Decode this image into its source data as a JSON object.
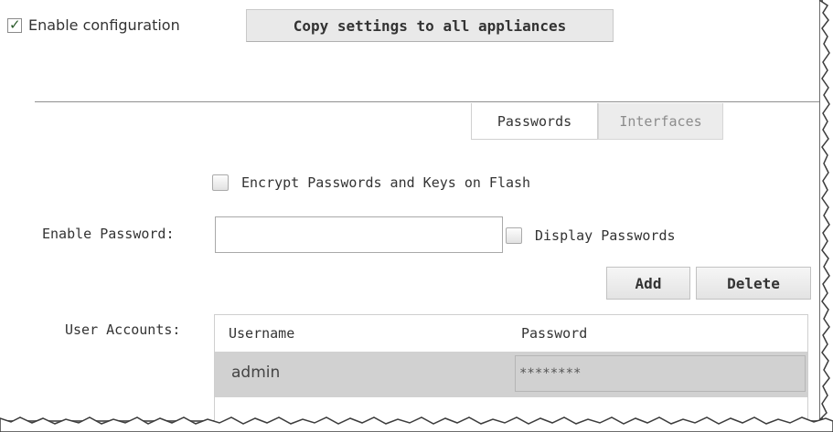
{
  "header": {
    "enable_label": "Enable configuration",
    "enable_checked": true,
    "copy_button": "Copy settings to all appliances"
  },
  "tabs": [
    {
      "label": "Passwords",
      "active": true
    },
    {
      "label": "Interfaces",
      "active": false
    }
  ],
  "form": {
    "encrypt_label": "Encrypt Passwords and Keys on Flash",
    "encrypt_checked": false,
    "enable_password_label": "Enable Password:",
    "enable_password_value": "",
    "display_passwords_label": "Display Passwords",
    "display_passwords_checked": false,
    "add_button": "Add",
    "delete_button": "Delete",
    "user_accounts_label": "User Accounts:"
  },
  "table": {
    "columns": [
      "Username",
      "Password"
    ],
    "rows": [
      {
        "username": "admin",
        "password": "********"
      }
    ]
  },
  "colors": {
    "selected_row": "#d1d1d1",
    "divider": "#8f8f8f",
    "inactive_tab": "#ececec"
  }
}
